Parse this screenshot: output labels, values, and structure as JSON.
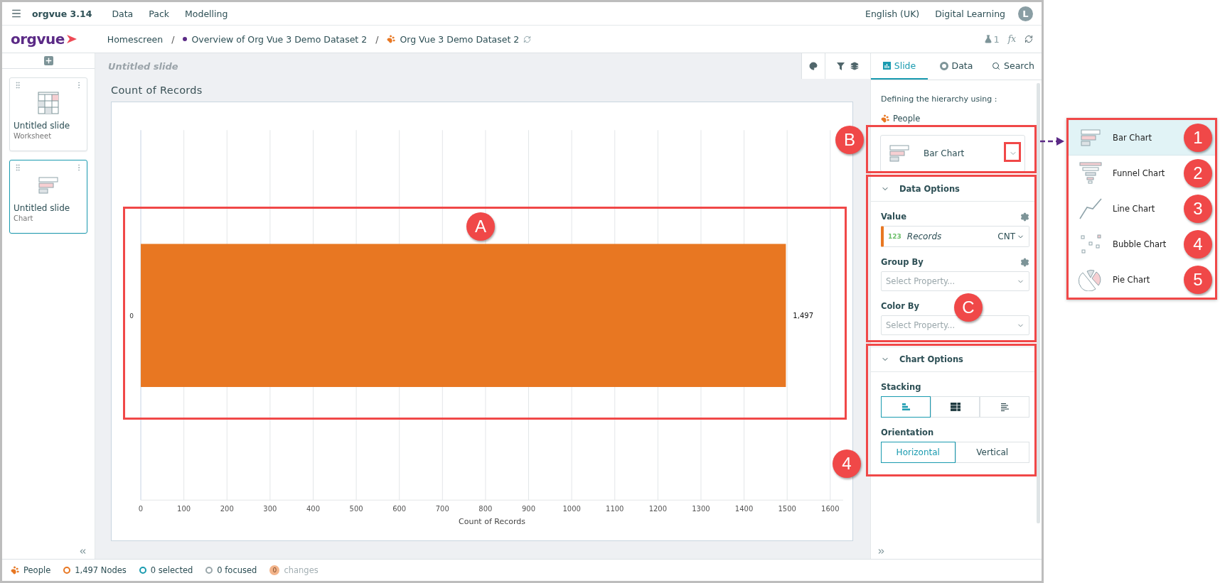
{
  "menu_bar": {
    "app_name": "orgvue 3.14",
    "menus": [
      "Data",
      "Pack",
      "Modelling"
    ],
    "language": "English (UK)",
    "user": "Digital Learning",
    "avatar_initial": "L"
  },
  "nav_bar": {
    "logo": "orgvue",
    "breadcrumbs": [
      {
        "label": "Homescreen",
        "kind": "plain"
      },
      {
        "label": "Overview of Org Vue 3 Demo Dataset 2",
        "kind": "dot"
      },
      {
        "label": "Org Vue 3 Demo Dataset 2",
        "kind": "dataset"
      }
    ],
    "separator": "/",
    "flask_count": "1",
    "formula_label": "fx"
  },
  "slides": [
    {
      "title": "Untitled slide",
      "type": "Worksheet",
      "kind": "worksheet",
      "selected": false
    },
    {
      "title": "Untitled slide",
      "type": "Chart",
      "kind": "chart",
      "selected": true
    }
  ],
  "canvas": {
    "slide_title": "Untitled slide",
    "chart_data": {
      "type": "bar",
      "orientation": "horizontal",
      "title": "Count of Records",
      "xlabel": "Count of Records",
      "categories": [
        "0"
      ],
      "values": [
        1497
      ],
      "xlim": [
        0,
        1630
      ],
      "xticks": [
        0,
        100,
        200,
        300,
        400,
        500,
        600,
        700,
        800,
        900,
        1000,
        1100,
        1200,
        1300,
        1400,
        1500,
        1600
      ],
      "grid": true,
      "value_labels": [
        "1,497"
      ]
    }
  },
  "side_panel": {
    "tabs": [
      {
        "label": "Slide",
        "kind": "slide",
        "selected": true
      },
      {
        "label": "Data",
        "kind": "data",
        "selected": false
      },
      {
        "label": "Search",
        "kind": "search",
        "selected": false
      }
    ],
    "hierarchy_label": "Defining the hierarchy using :",
    "hierarchy_source": "People",
    "chart_type": "Bar Chart",
    "data_options": {
      "title": "Data Options",
      "expanded": true,
      "value_label": "Value",
      "value_type": "123",
      "value_field": "Records",
      "aggregate": "CNT",
      "group_by_label": "Group By",
      "group_by_placeholder": "Select Property...",
      "color_by_label": "Color By",
      "color_by_placeholder": "Select Property..."
    },
    "chart_options": {
      "title": "Chart Options",
      "expanded": true,
      "stacking_label": "Stacking",
      "stacking": [
        {
          "kind": "grouped",
          "selected": true
        },
        {
          "kind": "stacked",
          "selected": false
        },
        {
          "kind": "percent",
          "selected": false
        }
      ],
      "orientation_label": "Orientation",
      "orientation": [
        {
          "label": "Horizontal",
          "selected": true
        },
        {
          "label": "Vertical",
          "selected": false
        }
      ]
    }
  },
  "status_bar": {
    "source": "People",
    "nodes": "1,497 Nodes",
    "selected": "0 selected",
    "focused": "0 focused",
    "changes_count": "0",
    "changes_label": "changes",
    "changes_disabled": true
  },
  "chart_type_menu": [
    {
      "label": "Bar Chart",
      "kind": "bar",
      "marker": "1",
      "selected": true
    },
    {
      "label": "Funnel Chart",
      "kind": "funnel",
      "marker": "2",
      "selected": false
    },
    {
      "label": "Line Chart",
      "kind": "line",
      "marker": "3",
      "selected": false
    },
    {
      "label": "Bubble Chart",
      "kind": "bubble",
      "marker": "4",
      "selected": false
    },
    {
      "label": "Pie Chart",
      "kind": "pie",
      "marker": "5",
      "selected": false
    }
  ],
  "annotations": [
    {
      "label": "A"
    },
    {
      "label": "B"
    },
    {
      "label": "C"
    },
    {
      "label": "4"
    }
  ]
}
